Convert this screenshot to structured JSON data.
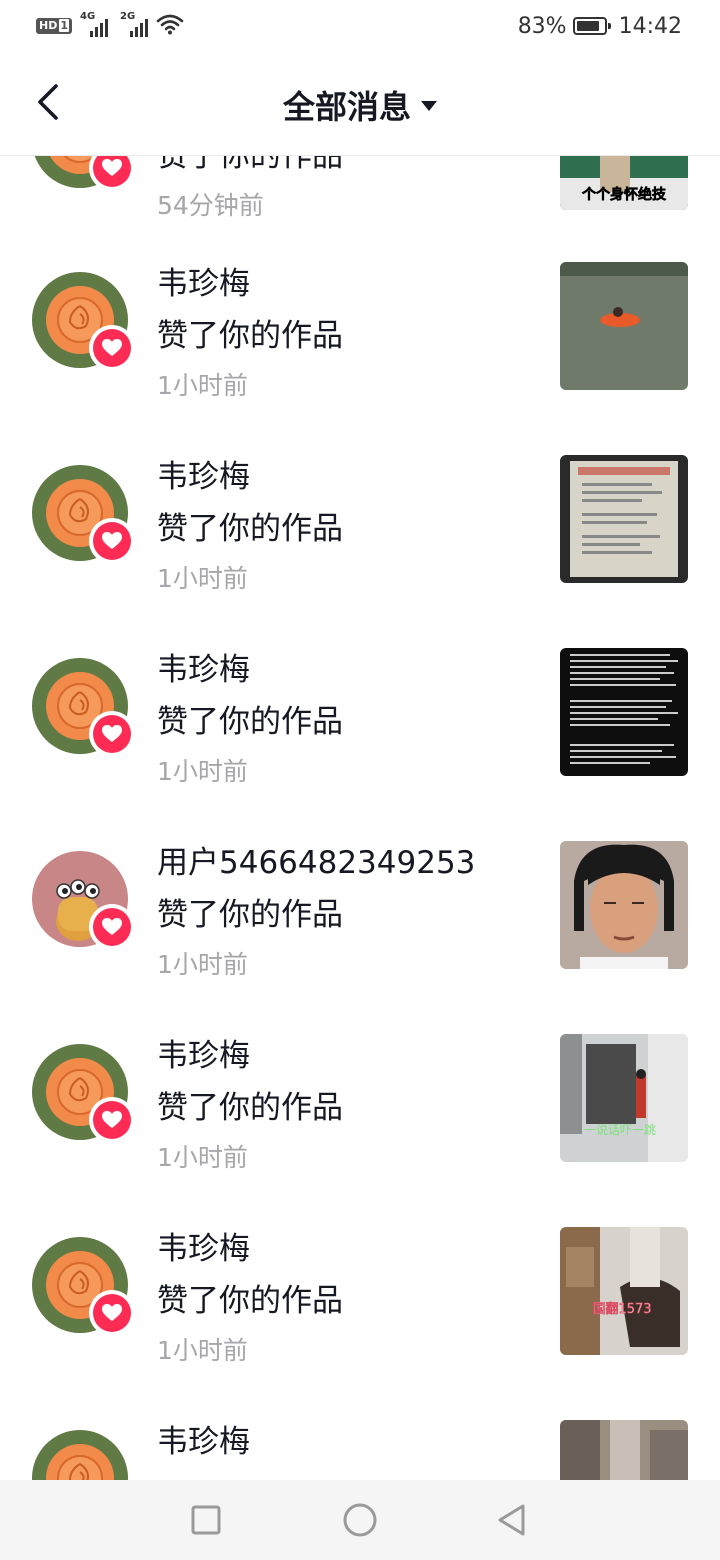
{
  "status_bar": {
    "hd_label": "HD",
    "sim_label": "1",
    "network_1": "4G",
    "network_2": "2G",
    "battery_percent": "83%",
    "battery_level": 0.83,
    "time": "14:42"
  },
  "header": {
    "title": "全部消息",
    "back_icon": "chevron-left-icon",
    "dropdown_icon": "caret-down-icon"
  },
  "notifications": [
    {
      "name": "",
      "action": "赞了你的作品",
      "time": "54分钟前",
      "avatar": "orange-rose",
      "thumbnail_caption": "个个身怀绝技"
    },
    {
      "name": "韦珍梅",
      "action": "赞了你的作品",
      "time": "1小时前",
      "avatar": "orange-rose",
      "thumbnail_caption": ""
    },
    {
      "name": "韦珍梅",
      "action": "赞了你的作品",
      "time": "1小时前",
      "avatar": "orange-rose",
      "thumbnail_caption": ""
    },
    {
      "name": "韦珍梅",
      "action": "赞了你的作品",
      "time": "1小时前",
      "avatar": "orange-rose",
      "thumbnail_caption": ""
    },
    {
      "name": "用户5466482349253",
      "action": "赞了你的作品",
      "time": "1小时前",
      "avatar": "cartoon-snail",
      "thumbnail_caption": ""
    },
    {
      "name": "韦珍梅",
      "action": "赞了你的作品",
      "time": "1小时前",
      "avatar": "orange-rose",
      "thumbnail_caption": "一说话吓一跳"
    },
    {
      "name": "韦珍梅",
      "action": "赞了你的作品",
      "time": "1小时前",
      "avatar": "orange-rose",
      "thumbnail_caption": "国翻1573"
    },
    {
      "name": "韦珍梅",
      "action": "",
      "time": "",
      "avatar": "orange-rose",
      "thumbnail_caption": ""
    }
  ],
  "colors": {
    "accent": "#fe2c55",
    "text_primary": "#161823",
    "text_secondary": "#a6a6ab",
    "background": "#ffffff"
  },
  "nav_bar": {
    "recents_icon": "square-icon",
    "home_icon": "circle-icon",
    "back_icon": "triangle-back-icon"
  }
}
